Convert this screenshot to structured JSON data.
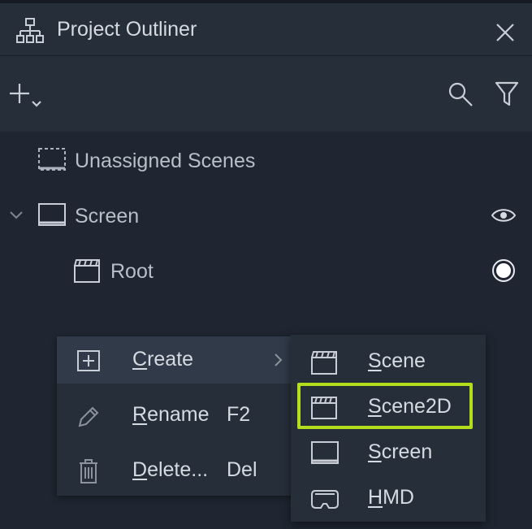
{
  "panel": {
    "title": "Project Outliner",
    "icons": [
      "hierarchy-icon",
      "close-icon",
      "add-icon",
      "chevron-down-icon",
      "search-icon",
      "filter-icon"
    ]
  },
  "tree": {
    "items": [
      {
        "label": "Unassigned Scenes",
        "icon": "dashed-screen-icon"
      },
      {
        "label": "Screen",
        "icon": "screen-icon",
        "expanded": true,
        "visibility": "eye-icon"
      },
      {
        "label": "Root",
        "icon": "clapperboard-icon",
        "state": "radio-selected"
      }
    ]
  },
  "context_menu": {
    "items": [
      {
        "label": "Create",
        "mnemonic": "C",
        "rest": "reate",
        "shortcut": "",
        "icon": "plus-box-icon",
        "has_submenu": true
      },
      {
        "label": "Rename",
        "mnemonic": "R",
        "rest": "ename",
        "shortcut": "F2",
        "icon": "pencil-icon"
      },
      {
        "label": "Delete...",
        "mnemonic": "D",
        "rest": "elete...",
        "shortcut": "Del",
        "icon": "trash-icon"
      }
    ]
  },
  "submenu": {
    "items": [
      {
        "label": "Scene",
        "mnemonic": "S",
        "rest": "cene",
        "icon": "clapperboard-icon"
      },
      {
        "label": "Scene2D",
        "mnemonic": "S",
        "rest": "cene2D",
        "icon": "clapperboard-2d-icon",
        "highlighted": true
      },
      {
        "label": "Screen",
        "mnemonic": "S",
        "rest": "creen",
        "icon": "screen-icon"
      },
      {
        "label": "HMD",
        "mnemonic": "H",
        "rest": "MD",
        "icon": "vr-headset-icon"
      }
    ]
  },
  "colors": {
    "background": "#1f2631",
    "header": "#262e3a",
    "menu_active": "#303a48",
    "highlight": "#b4dd1e",
    "text": "#d6dae1"
  }
}
